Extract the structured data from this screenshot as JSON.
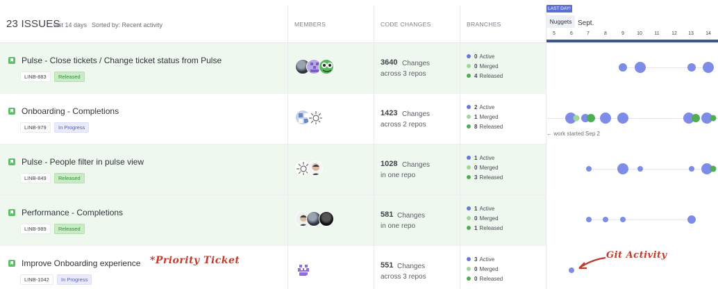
{
  "header": {
    "title": "23 ISSUES",
    "range": "last 14 days",
    "sorted": "Sorted by: Recent activity",
    "col_members": "MEMBERS",
    "col_code": "CODE CHANGES",
    "col_branches": "BRANCHES"
  },
  "timeline": {
    "last_day_badge": "LAST DAY!",
    "tab": "Nuggets",
    "month": "Sept.",
    "days": [
      "5",
      "6",
      "7",
      "8",
      "9",
      "10",
      "11",
      "12",
      "13",
      "14"
    ]
  },
  "branch_labels": {
    "active": "Active",
    "merged": "Merged",
    "released": "Released"
  },
  "colors": {
    "active": "#6677dd",
    "merged": "#9ed79a",
    "released": "#4fae53",
    "bubble": "#7d8ce6",
    "annotation": "#c13a2b"
  },
  "issues": [
    {
      "title": "Pulse - Close tickets / Change ticket status from Pulse",
      "id": "LINB-883",
      "status": "Released",
      "changes": "3640",
      "changes_label": "Changes",
      "repos": "across 3 repos",
      "active": "0",
      "merged": "0",
      "released": "4",
      "members": [
        "photo-avatar",
        "pixel-avatar",
        "frog-avatar"
      ]
    },
    {
      "title": "Onboarding - Completions",
      "id": "LINB-979",
      "status": "In Progress",
      "changes": "1423",
      "changes_label": "Changes",
      "repos": "across 2 repos",
      "active": "2",
      "merged": "1",
      "released": "8",
      "members": [
        "pixel-avatar",
        "sun-avatar"
      ]
    },
    {
      "title": "Pulse - People filter in pulse view",
      "id": "LINB-849",
      "status": "Released",
      "changes": "1028",
      "changes_label": "Changes",
      "repos": "in one repo",
      "active": "1",
      "merged": "0",
      "released": "3",
      "members": [
        "sun-avatar",
        "person-avatar"
      ]
    },
    {
      "title": "Performance - Completions",
      "id": "LINB-989",
      "status": "Released",
      "changes": "581",
      "changes_label": "Changes",
      "repos": "in one repo",
      "active": "1",
      "merged": "0",
      "released": "1",
      "members": [
        "person-avatar",
        "photo-avatar",
        "dark-avatar"
      ]
    },
    {
      "title": "Improve Onboarding experience",
      "id": "LINB-1042",
      "status": "In Progress",
      "changes": "551",
      "changes_label": "Changes",
      "repos": "across 3 repos",
      "active": "3",
      "merged": "0",
      "released": "0",
      "members": [
        "pixel-avatar"
      ]
    }
  ],
  "annotations": {
    "work_started": "work started Sep 2",
    "priority": "*Priority Ticket",
    "git_activity": "Git Activity"
  }
}
